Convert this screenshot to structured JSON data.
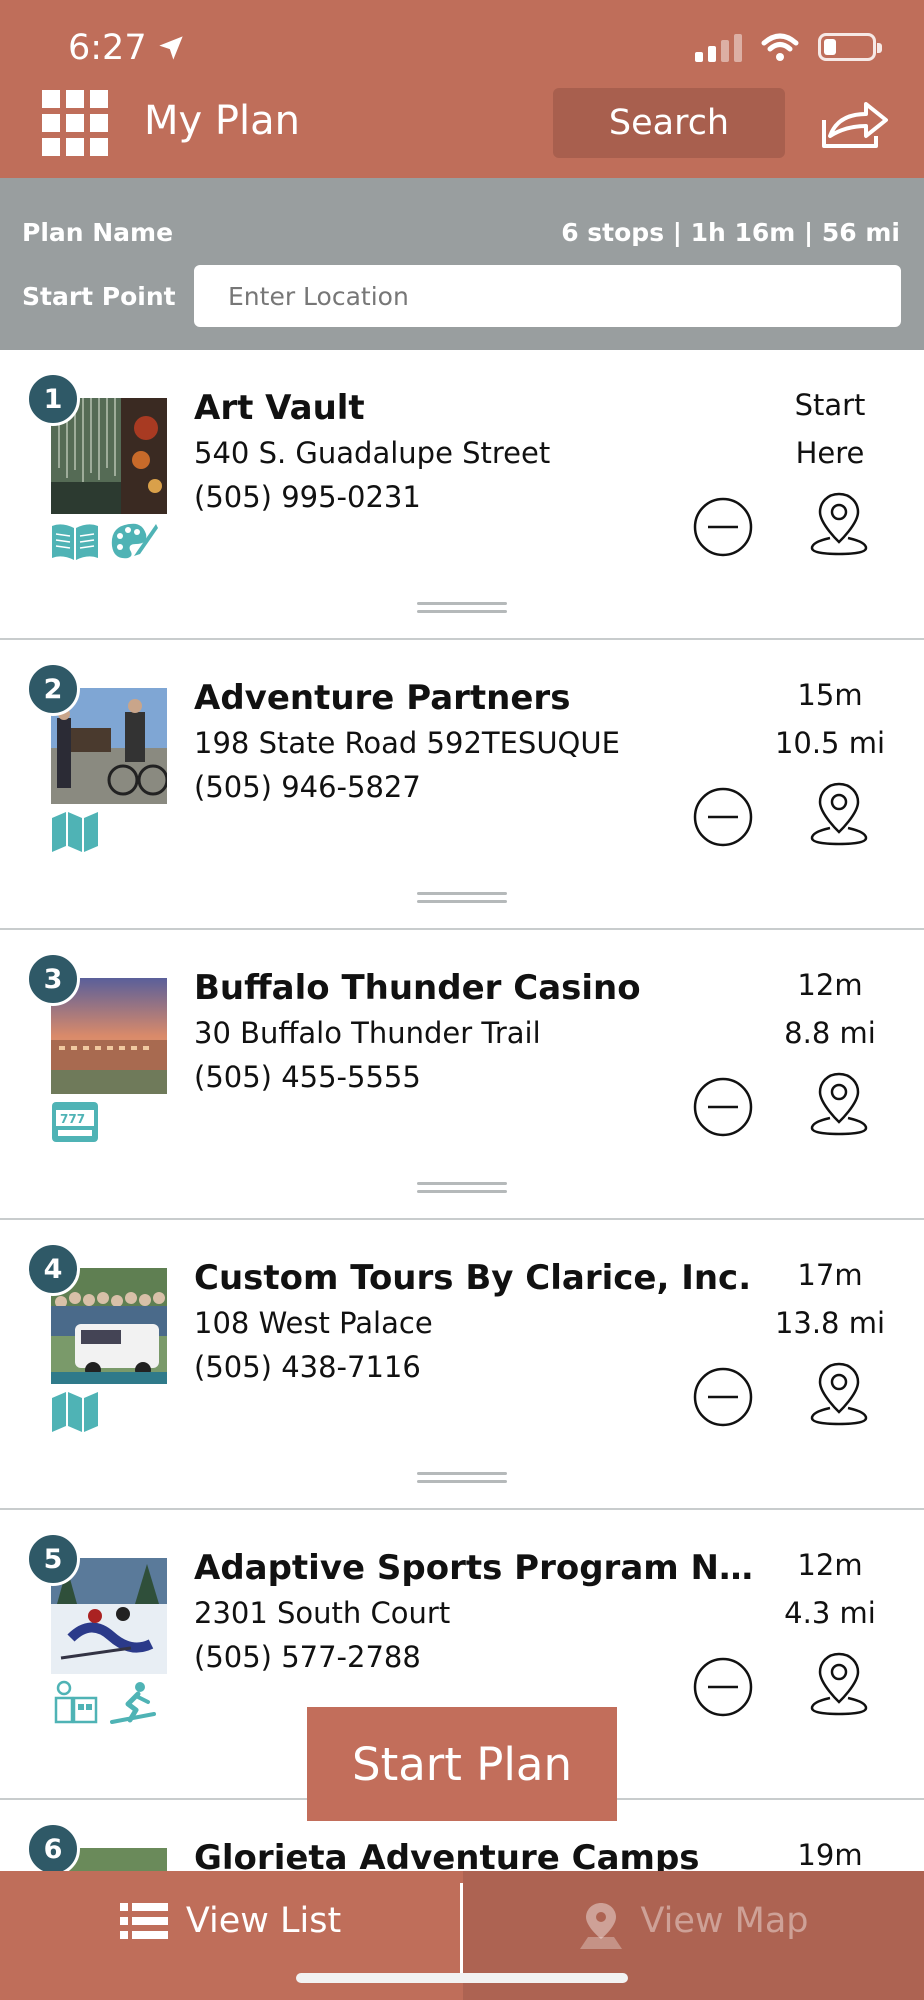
{
  "status_bar": {
    "time": "6:27"
  },
  "header": {
    "title": "My Plan",
    "search_label": "Search"
  },
  "plan": {
    "name_label": "Plan Name",
    "stats": "6 stops | 1h 16m | 56 mi",
    "start_label": "Start Point",
    "start_placeholder": "Enter Location"
  },
  "stops": [
    {
      "number": "1",
      "name": "Art Vault",
      "address": "540 S. Guadalupe Street",
      "phone": "(505) 995-0231",
      "meta1": "Start",
      "meta2": "Here",
      "categories": [
        "book-icon",
        "palette-icon"
      ]
    },
    {
      "number": "2",
      "name": "Adventure Partners",
      "address": "198 State Road 592TESUQUE",
      "phone": "(505) 946-5827",
      "meta1": "15m",
      "meta2": "10.5 mi",
      "categories": [
        "map-icon"
      ]
    },
    {
      "number": "3",
      "name": "Buffalo Thunder Casino",
      "address": "30 Buffalo Thunder Trail",
      "phone": "(505) 455-5555",
      "meta1": "12m",
      "meta2": "8.8 mi",
      "categories": [
        "slot-machine-icon"
      ]
    },
    {
      "number": "4",
      "name": "Custom Tours By Clarice, Inc.",
      "address": "108 West Palace",
      "phone": "(505) 438-7116",
      "meta1": "17m",
      "meta2": "13.8 mi",
      "categories": [
        "map-icon"
      ]
    },
    {
      "number": "5",
      "name": "Adaptive Sports Program New...",
      "address": "2301 South Court",
      "phone": "(505) 577-2788",
      "meta1": "12m",
      "meta2": "4.3 mi",
      "categories": [
        "ski-lodge-icon",
        "skier-icon"
      ]
    },
    {
      "number": "6",
      "name": "Glorieta Adventure Camps",
      "meta1": "19m"
    }
  ],
  "start_plan_label": "Start Plan",
  "bottom_nav": {
    "list_label": "View List",
    "map_label": "View Map"
  },
  "colors": {
    "brand": "#bf6e5a",
    "plan_bar": "#999e9f",
    "number_badge": "#2f5967",
    "category_icon": "#4fb3b5"
  }
}
